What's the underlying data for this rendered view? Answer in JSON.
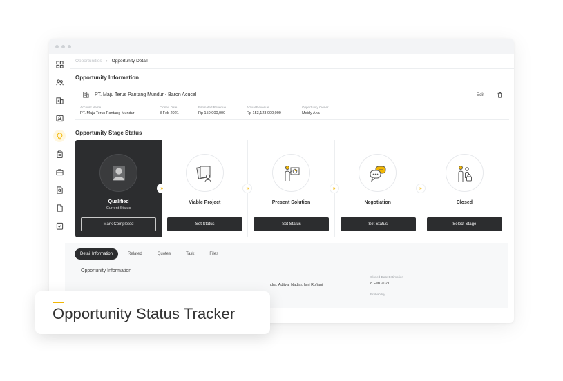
{
  "breadcrumb": {
    "parent": "Opportunities",
    "current": "Opportunity Detail"
  },
  "sidebar": {
    "items": [
      {
        "icon": "dashboard-icon"
      },
      {
        "icon": "users-icon"
      },
      {
        "icon": "building-icon"
      },
      {
        "icon": "contact-card-icon"
      },
      {
        "icon": "lightbulb-icon",
        "active": true
      },
      {
        "icon": "clipboard-icon"
      },
      {
        "icon": "briefcase-icon"
      },
      {
        "icon": "search-document-icon"
      },
      {
        "icon": "document-icon"
      },
      {
        "icon": "checklist-icon"
      }
    ]
  },
  "opportunity": {
    "section_title": "Opportunity Information",
    "name": "PT. Maju Terus Pantang Mundur - Baron Acucel",
    "edit_label": "Edit",
    "fields": [
      {
        "label": "Account Name",
        "value": "PT. Maju Terus Pantang Mundur"
      },
      {
        "label": "Closed Date",
        "value": "8 Feb 2021"
      },
      {
        "label": "Estimated Revenue",
        "value": "Rp 150,000,000"
      },
      {
        "label": "Actual Revenue",
        "value": "Rp 153,123,000,000"
      },
      {
        "label": "Opportunity Owner",
        "value": "Meidy Ana"
      }
    ]
  },
  "stage_status": {
    "section_title": "Opportunity Stage Status",
    "stages": [
      {
        "label": "Qualified",
        "sub": "Current Status",
        "button": "Mark Completed",
        "icon": "person-silhouette-icon"
      },
      {
        "label": "Viable Project",
        "button": "Set Status",
        "icon": "documents-person-icon"
      },
      {
        "label": "Present Solution",
        "button": "Set Status",
        "icon": "presentation-icon"
      },
      {
        "label": "Negotiation",
        "button": "Set Status",
        "icon": "chat-bubbles-icon"
      },
      {
        "label": "Closed",
        "button": "Select Stage",
        "icon": "people-lock-icon"
      }
    ],
    "chevron": "»"
  },
  "tabs": [
    "Detail Information",
    "Related",
    "Quotes",
    "Task",
    "Files"
  ],
  "detail": {
    "title": "Opportunity Information",
    "members_partial": "ndra, Aditya, Nadiar, Isni Rofiani",
    "closed_date_label": "Closed Date Estimation",
    "closed_date_value": "8 Feb 2021",
    "probability_label": "Probability"
  },
  "badge": {
    "title": "Opportunity Status Tracker"
  },
  "colors": {
    "accent": "#f2b705",
    "dark": "#2c2d2f"
  }
}
